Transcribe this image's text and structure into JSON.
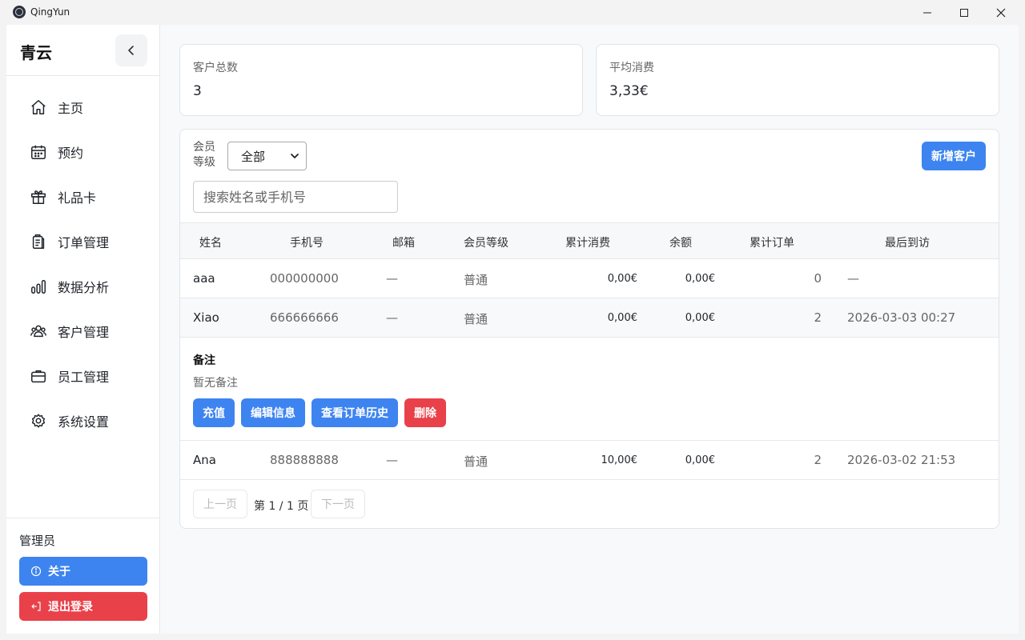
{
  "window": {
    "title": "QingYun"
  },
  "sidebar": {
    "brand": "青云",
    "items": [
      {
        "label": "主页",
        "icon": "home-icon"
      },
      {
        "label": "预约",
        "icon": "calendar-icon"
      },
      {
        "label": "礼品卡",
        "icon": "gift-icon"
      },
      {
        "label": "订单管理",
        "icon": "clipboard-icon"
      },
      {
        "label": "数据分析",
        "icon": "bar-chart-icon"
      },
      {
        "label": "客户管理",
        "icon": "users-icon"
      },
      {
        "label": "员工管理",
        "icon": "briefcase-icon"
      },
      {
        "label": "系统设置",
        "icon": "gear-icon"
      }
    ],
    "user_role": "管理员",
    "about_label": "关于",
    "logout_label": "退出登录"
  },
  "stats": {
    "total_label": "客户总数",
    "total_value": "3",
    "avg_label": "平均消费",
    "avg_value": "3,33€"
  },
  "filter": {
    "level_label": "会员等级",
    "level_selected": "全部",
    "add_label": "新增客户",
    "search_placeholder": "搜索姓名或手机号"
  },
  "table": {
    "headers": [
      "姓名",
      "手机号",
      "邮箱",
      "会员等级",
      "累计消费",
      "余额",
      "累计订单",
      "最后到访"
    ],
    "rows": [
      {
        "name": "aaa",
        "phone": "000000000",
        "email": "—",
        "level": "普通",
        "spent": "0,00€",
        "balance": "0,00€",
        "orders": "0",
        "last_visit": "—"
      },
      {
        "name": "Xiao",
        "phone": "666666666",
        "email": "—",
        "level": "普通",
        "spent": "0,00€",
        "balance": "0,00€",
        "orders": "2",
        "last_visit": "2026-03-03 00:27"
      },
      {
        "name": "Ana",
        "phone": "888888888",
        "email": "—",
        "level": "普通",
        "spent": "10,00€",
        "balance": "0,00€",
        "orders": "2",
        "last_visit": "2026-03-02 21:53"
      }
    ]
  },
  "detail": {
    "title": "备注",
    "note": "暂无备注",
    "recharge_label": "充值",
    "edit_label": "编辑信息",
    "history_label": "查看订单历史",
    "delete_label": "删除"
  },
  "pagination": {
    "prev_label": "上一页",
    "page_text": "第 1 / 1 页",
    "next_label": "下一页"
  },
  "colors": {
    "accent": "#3d84f0",
    "danger": "#e9414a"
  }
}
